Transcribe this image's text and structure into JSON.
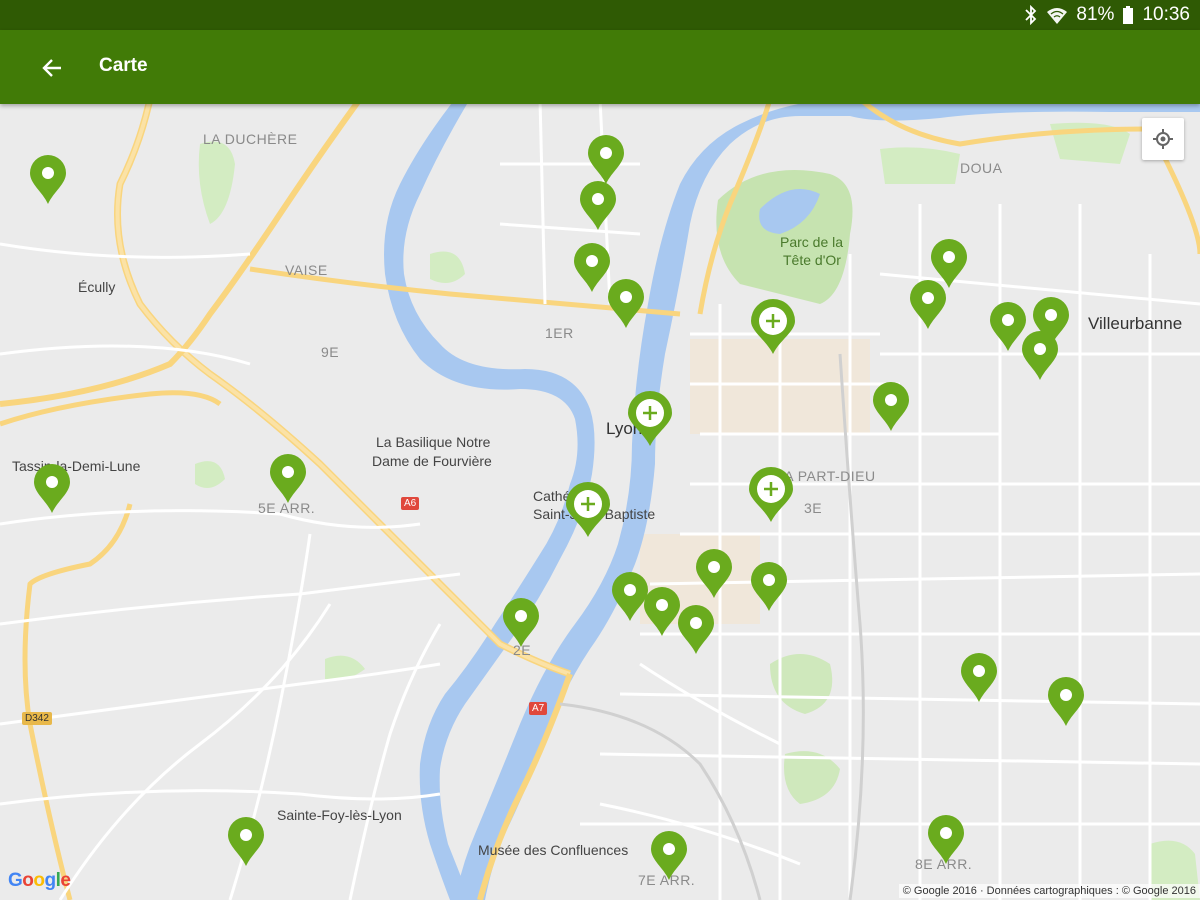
{
  "status_bar": {
    "battery_percent": "81%",
    "time": "10:36",
    "icons": [
      "bluetooth-icon",
      "wifi-icon",
      "battery-icon"
    ]
  },
  "app_bar": {
    "title": "Carte",
    "back_icon": "arrow-back-icon",
    "color": "#417b07"
  },
  "map": {
    "labels": {
      "la_duchere": "LA DUCHÈRE",
      "ecully": "Écully",
      "vaise": "VAISE",
      "ninth": "9E",
      "first": "1ER",
      "doua": "DOUA",
      "parc": "Parc de la",
      "parc2": "Tête d'Or",
      "villeurbanne": "Villeurbanne",
      "lyon": "Lyon",
      "part_dieu": "LA PART-DIEU",
      "third": "3E",
      "basilique": "La Basilique Notre",
      "basilique2": "Dame de Fourvière",
      "cathedrale": "Cathédrale",
      "cathedrale2": "Saint-Jean-Baptiste",
      "tassin": "Tassin-la-Demi-Lune",
      "fifth": "5E ARR.",
      "second": "2E",
      "sainte_foy": "Sainte-Foy-lès-Lyon",
      "musee": "Musée des Confluences",
      "seventh": "7E ARR.",
      "eighth": "8E ARR."
    },
    "shields": {
      "a6": "A6",
      "a7": "A7",
      "d342": "D342"
    },
    "marker_color": "#6aab1e",
    "marker_count": 29,
    "cluster_count": 4,
    "locate_icon": "my-location-icon",
    "google_logo": "Google",
    "copyright": "© Google 2016 · Données cartographiques : © Google 2016"
  }
}
